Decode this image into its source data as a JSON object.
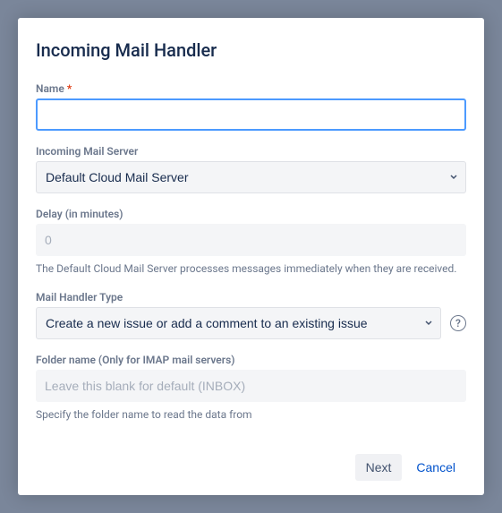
{
  "modal": {
    "title": "Incoming Mail Handler"
  },
  "fields": {
    "name": {
      "label": "Name",
      "required_mark": "*",
      "value": ""
    },
    "server": {
      "label": "Incoming Mail Server",
      "selected": "Default Cloud Mail Server"
    },
    "delay": {
      "label": "Delay (in minutes)",
      "placeholder": "0",
      "helper": "The Default Cloud Mail Server processes messages immediately when they are received."
    },
    "handler": {
      "label": "Mail Handler Type",
      "selected": "Create a new issue or add a comment to an existing issue",
      "help_glyph": "?"
    },
    "folder": {
      "label": "Folder name (Only for IMAP mail servers)",
      "placeholder": "Leave this blank for default (INBOX)",
      "helper": "Specify the folder name to read the data from"
    }
  },
  "footer": {
    "next": "Next",
    "cancel": "Cancel"
  }
}
